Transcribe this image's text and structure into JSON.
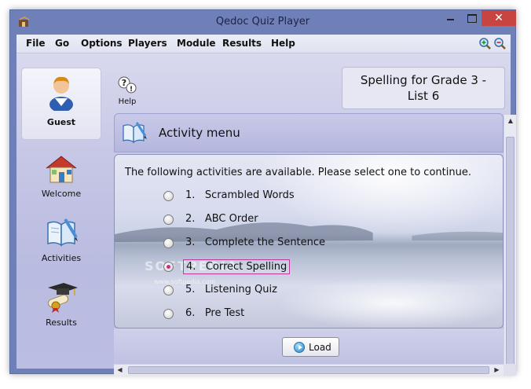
{
  "window": {
    "title": "Qedoc Quiz Player",
    "close_glyph": "✕"
  },
  "menu": [
    "File",
    "Go",
    "Options",
    "Players",
    "Module",
    "Results",
    "Help"
  ],
  "toolbar": {
    "zoom_in_icon": "zoom-in-icon",
    "zoom_out_icon": "zoom-out-icon"
  },
  "sidebar": {
    "user": {
      "label": "Guest",
      "icon": "user-icon"
    },
    "items": [
      {
        "label": "Welcome",
        "icon": "house-icon"
      },
      {
        "label": "Activities",
        "icon": "book-icon"
      },
      {
        "label": "Results",
        "icon": "graduation-icon"
      }
    ]
  },
  "help": {
    "label": "Help",
    "icon": "help-icon"
  },
  "quiz_title": {
    "line1": "Spelling for Grade 3 -",
    "line2": "List 6"
  },
  "activity": {
    "header": "Activity menu",
    "intro": "The following activities are available. Please select one to continue.",
    "options": [
      {
        "number": "1.",
        "label": "Scrambled Words",
        "selected": false
      },
      {
        "number": "2.",
        "label": "ABC Order",
        "selected": false
      },
      {
        "number": "3.",
        "label": "Complete the Sentence",
        "selected": false
      },
      {
        "number": "4.",
        "label": "Correct Spelling",
        "selected": true
      },
      {
        "number": "5.",
        "label": "Listening Quiz",
        "selected": false
      },
      {
        "number": "6.",
        "label": "Pre Test",
        "selected": false
      }
    ],
    "load_label": "Load"
  },
  "watermark": {
    "main": "SOFTPEDIA",
    "sub": "www.softpedia.com"
  },
  "colors": {
    "titlebar": "#6f7fb8",
    "close_button": "#c74440",
    "selected_radio": "#c32f8c"
  }
}
